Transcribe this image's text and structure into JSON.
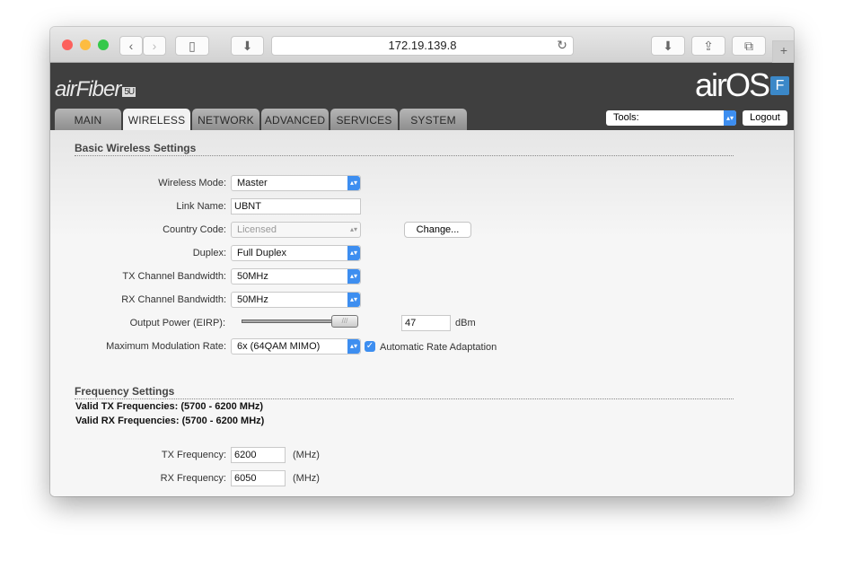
{
  "browser": {
    "url": "172.19.139.8"
  },
  "header": {
    "logo_left": "airFiber",
    "logo_left_badge": "5U",
    "logo_right": "airOS",
    "logo_right_badge": "F"
  },
  "tabs": [
    "MAIN",
    "WIRELESS",
    "NETWORK",
    "ADVANCED",
    "SERVICES",
    "SYSTEM"
  ],
  "active_tab": "WIRELESS",
  "tools": {
    "label": "Tools:",
    "logout": "Logout"
  },
  "basic": {
    "title": "Basic Wireless Settings",
    "wireless_mode_label": "Wireless Mode:",
    "wireless_mode": "Master",
    "link_name_label": "Link Name:",
    "link_name": "UBNT",
    "country_code_label": "Country Code:",
    "country_code": "Licensed",
    "change_button": "Change...",
    "duplex_label": "Duplex:",
    "duplex": "Full Duplex",
    "tx_bw_label": "TX Channel Bandwidth:",
    "tx_bw": "50MHz",
    "rx_bw_label": "RX Channel Bandwidth:",
    "rx_bw": "50MHz",
    "output_power_label": "Output Power (EIRP):",
    "output_power": "47",
    "output_power_unit": "dBm",
    "output_power_slider_fraction": 1.0,
    "mod_rate_label": "Maximum Modulation Rate:",
    "mod_rate": "6x (64QAM MIMO)",
    "auto_rate_label": "Automatic Rate Adaptation",
    "auto_rate_checked": true
  },
  "freq": {
    "title": "Frequency Settings",
    "valid_tx": "Valid TX Frequencies: (5700 - 6200 MHz)",
    "valid_rx": "Valid RX Frequencies: (5700 - 6200 MHz)",
    "tx_label": "TX Frequency:",
    "tx": "6200",
    "rx_label": "RX Frequency:",
    "rx": "6050",
    "unit": "(MHz)"
  }
}
